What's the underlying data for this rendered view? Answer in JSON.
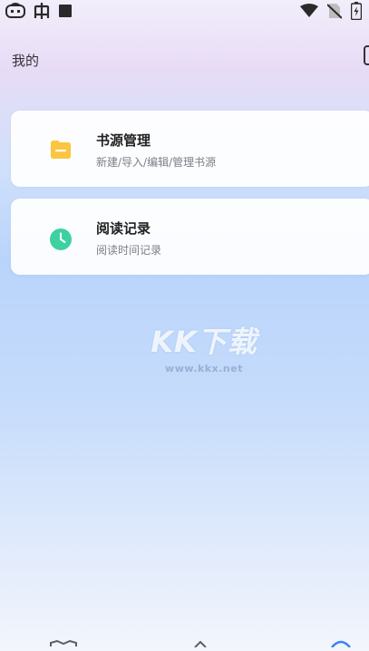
{
  "status_bar": {
    "icons": [
      "app-notification-icon",
      "bug-icon",
      "square-icon",
      "wifi-icon",
      "no-sim-icon",
      "battery-charging-icon"
    ]
  },
  "header": {
    "title": "我的"
  },
  "menu": [
    {
      "title": "书源管理",
      "subtitle": "新建/导入/编辑/管理书源",
      "icon": "folder-icon",
      "icon_color": "#fbc53f"
    },
    {
      "title": "阅读记录",
      "subtitle": "阅读时间记录",
      "icon": "clock-icon",
      "icon_color": "#3ed1a0"
    }
  ],
  "watermark": {
    "logo": "KK下载",
    "url": "www.kkx.net"
  },
  "bottom_nav": {
    "icons": [
      "bookshelf-icon",
      "explore-icon",
      "profile-icon"
    ]
  }
}
